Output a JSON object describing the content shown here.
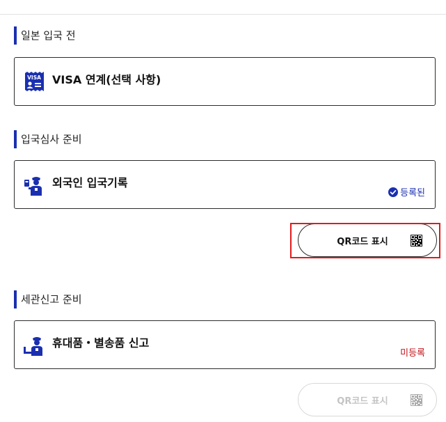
{
  "sections": [
    {
      "heading": "일본 입국 전",
      "card": {
        "title": "VISA 연계(선택 사항)",
        "icon": "visa-icon"
      }
    },
    {
      "heading": "입국심사 준비",
      "card": {
        "title": "외국인 입국기록",
        "icon": "immigration-officer-icon",
        "status": "등록된"
      },
      "qr_button": {
        "label": "QR코드 표시",
        "enabled": true
      }
    },
    {
      "heading": "세관신고 준비",
      "card": {
        "title": "휴대품・별송품 신고",
        "icon": "customs-officer-icon",
        "status": "미등록"
      },
      "qr_button": {
        "label": "QR코드 표시",
        "enabled": false
      }
    }
  ],
  "colors": {
    "accent": "#1a2fb0",
    "registered": "#1a2fb0",
    "unregistered": "#c0141b",
    "highlight": "#e01a1a"
  }
}
